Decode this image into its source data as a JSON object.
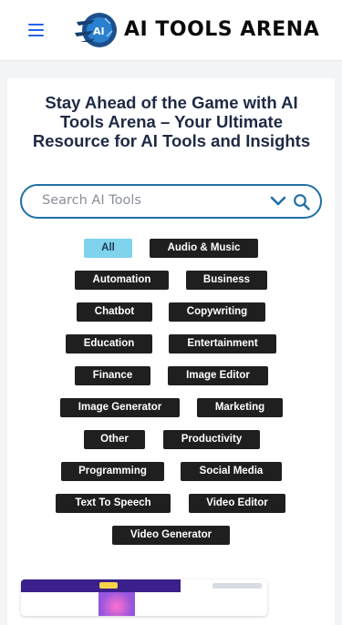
{
  "header": {
    "menu_icon": "hamburger-icon",
    "logo_text": "AI TOOLS ARENA"
  },
  "hero": {
    "headline": "Stay Ahead of the Game with AI Tools Arena – Your Ultimate Resource for AI Tools and Insights"
  },
  "search": {
    "placeholder": "Search AI Tools",
    "dropdown_icon": "chevron-down-icon",
    "search_icon": "search-icon"
  },
  "categories": [
    "All",
    "Audio & Music",
    "Automation",
    "Business",
    "Chatbot",
    "Copywriting",
    "Education",
    "Entertainment",
    "Finance",
    "Image Editor",
    "Image Generator",
    "Marketing",
    "Other",
    "Productivity",
    "Programming",
    "Social Media",
    "Text To Speech",
    "Video Editor",
    "Video Generator"
  ],
  "active_category": "All",
  "colors": {
    "accent": "#2563eb",
    "active_tag": "#7fd3ec",
    "tag_bg": "#1f1f1f",
    "search_border": "#1f6fa6",
    "headline": "#1e2a44"
  }
}
